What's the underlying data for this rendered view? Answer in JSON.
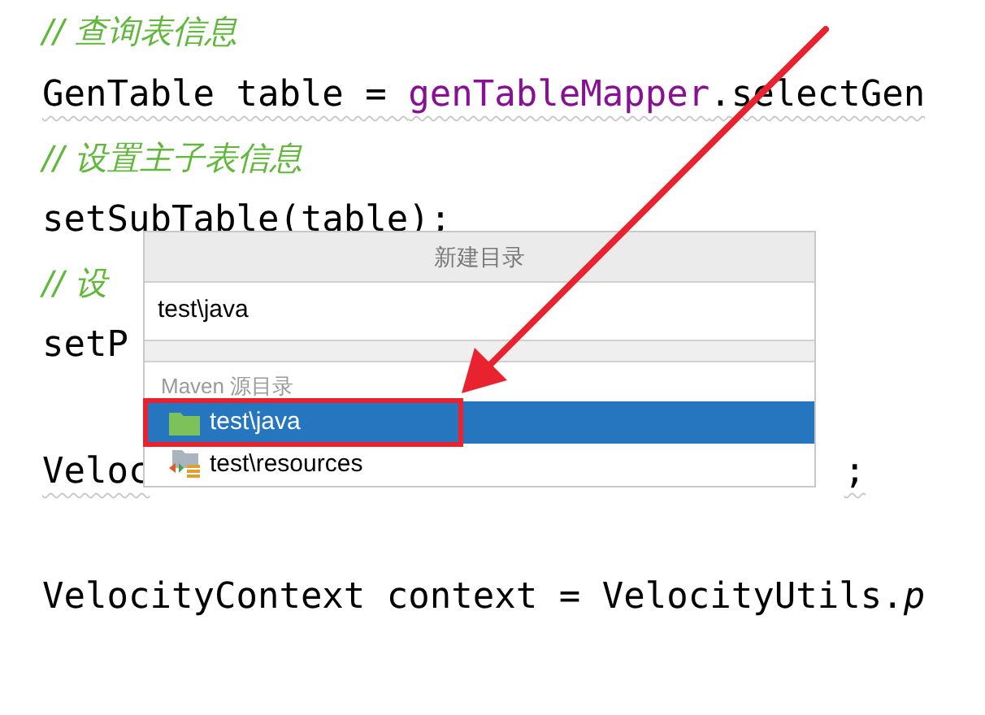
{
  "editor": {
    "lines": [
      {
        "tokens": [
          {
            "text": "// 查询表信息",
            "kind": "comment"
          }
        ]
      },
      {
        "underline": true,
        "tokens": [
          {
            "text": "GenTable table = ",
            "kind": "plain"
          },
          {
            "text": "genTableMapper",
            "kind": "field"
          },
          {
            "text": ".selectGen",
            "kind": "plain"
          }
        ]
      },
      {
        "tokens": [
          {
            "text": "// 设置主子表信息",
            "kind": "comment"
          }
        ]
      },
      {
        "tokens": [
          {
            "text": "setSubTable(table);",
            "kind": "plain"
          }
        ]
      },
      {
        "tokens": [
          {
            "text": "// 设",
            "kind": "comment"
          }
        ]
      },
      {
        "tokens": [
          {
            "text": "setP",
            "kind": "plain"
          }
        ]
      },
      {
        "space_before": true,
        "underline": true,
        "tokens": [
          {
            "text": "Veloc",
            "kind": "plain"
          },
          {
            "text": ";",
            "kind": "trailing"
          }
        ]
      },
      {
        "space_before": true,
        "tokens": [
          {
            "text": "VelocityContext context = VelocityUtils.",
            "kind": "plain"
          },
          {
            "text": "p",
            "kind": "italic"
          }
        ]
      }
    ]
  },
  "dialog": {
    "title": "新建目录",
    "value": "test\\java",
    "section": "Maven 源目录",
    "items": [
      {
        "label": "test\\java",
        "kind": "source",
        "selected": true
      },
      {
        "label": "test\\resources",
        "kind": "resources",
        "selected": false
      }
    ]
  }
}
